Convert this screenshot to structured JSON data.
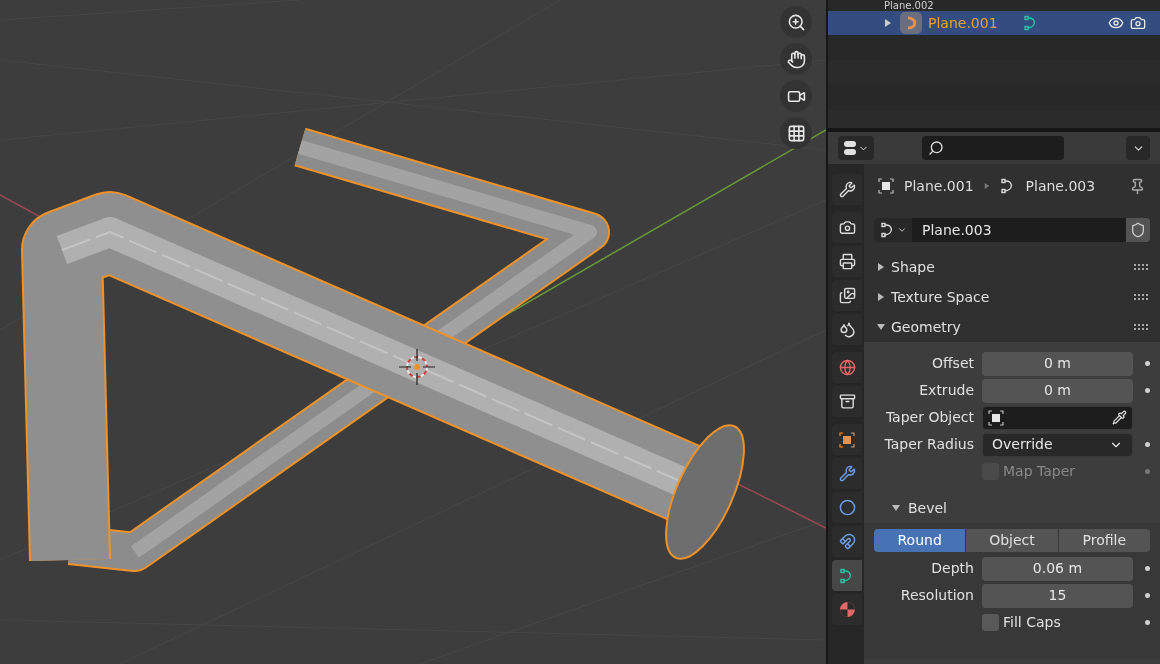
{
  "outliner": {
    "rows": [
      {
        "name": "Plane.002",
        "selected": false
      },
      {
        "name": "Plane.001",
        "selected": true,
        "expanded": false
      }
    ]
  },
  "properties": {
    "tabs": [
      {
        "selected": false
      },
      {
        "selected": false
      },
      {
        "selected": false
      },
      {
        "selected": false
      },
      {
        "selected": false
      },
      {
        "selected": false
      },
      {
        "selected": false
      },
      {
        "selected": false
      },
      {
        "selected": false
      },
      {
        "selected": false
      },
      {
        "selected": false
      },
      {
        "selected": true
      },
      {
        "selected": false
      }
    ],
    "breadcrumb": [
      "Plane.001",
      "Plane.003"
    ],
    "datablock": "Plane.003",
    "panels": [
      {
        "title": "Shape",
        "expanded": false
      },
      {
        "title": "Texture Space",
        "expanded": false
      },
      {
        "title": "Geometry",
        "expanded": true
      }
    ],
    "geometry_fields": [
      {
        "kind": "number",
        "label": "Offset",
        "value": "0 m"
      },
      {
        "kind": "number",
        "label": "Extrude",
        "value": "0 m"
      },
      {
        "kind": "object",
        "label": "Taper Object"
      },
      {
        "kind": "dropdown",
        "label": "Taper Radius",
        "value": "Override"
      },
      {
        "kind": "checkbox",
        "label": "Map Taper",
        "checked": false,
        "disabled": true
      }
    ],
    "bevel": {
      "title": "Bevel",
      "expanded": true,
      "modes": [
        {
          "label": "Round",
          "selected": true
        },
        {
          "label": "Object",
          "selected": false
        },
        {
          "label": "Profile",
          "selected": false
        }
      ],
      "fields": [
        {
          "kind": "number",
          "label": "Depth",
          "value": "0.06 m"
        },
        {
          "kind": "number",
          "label": "Resolution",
          "value": "15"
        },
        {
          "kind": "checkbox",
          "label": "Fill Caps",
          "checked": false,
          "disabled": false
        }
      ]
    }
  }
}
